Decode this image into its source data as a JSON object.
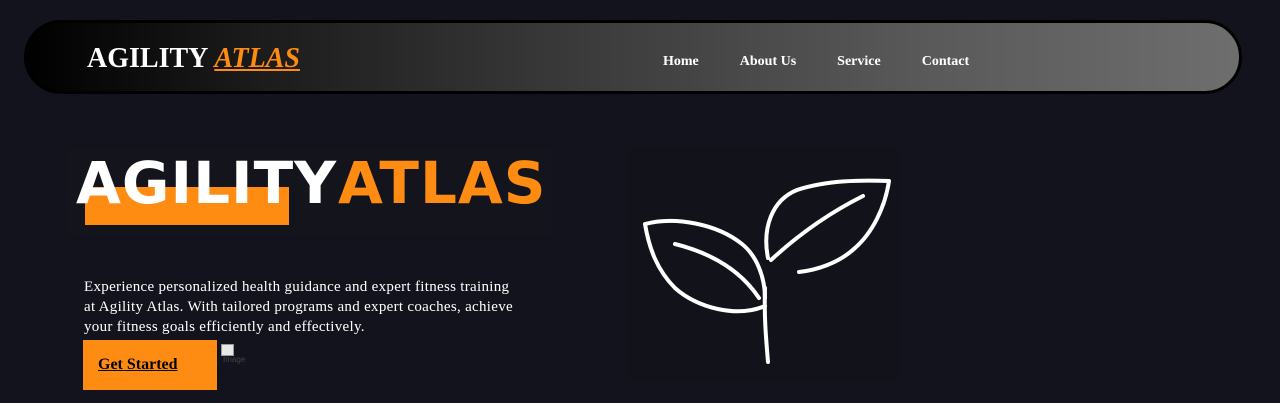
{
  "navbar": {
    "brand_main": "AGILITY",
    "brand_accent": "ATLAS",
    "links": [
      "Home",
      "About Us",
      "Service",
      "Contact"
    ]
  },
  "hero": {
    "logo_word_1": "AGILITY",
    "logo_word_2": "ATLAS",
    "description": "Experience personalized health guidance and expert fitness training at Agility Atlas. With tailored programs and expert coaches, achieve your fitness goals efficiently and effectively.",
    "cta_label": "Get Started",
    "broken_image_alt": "Image"
  },
  "colors": {
    "background": "#12131c",
    "accent": "#ff8c12",
    "text": "#ffffff"
  },
  "icons": {
    "illustration": "leaf-sprout-icon"
  }
}
